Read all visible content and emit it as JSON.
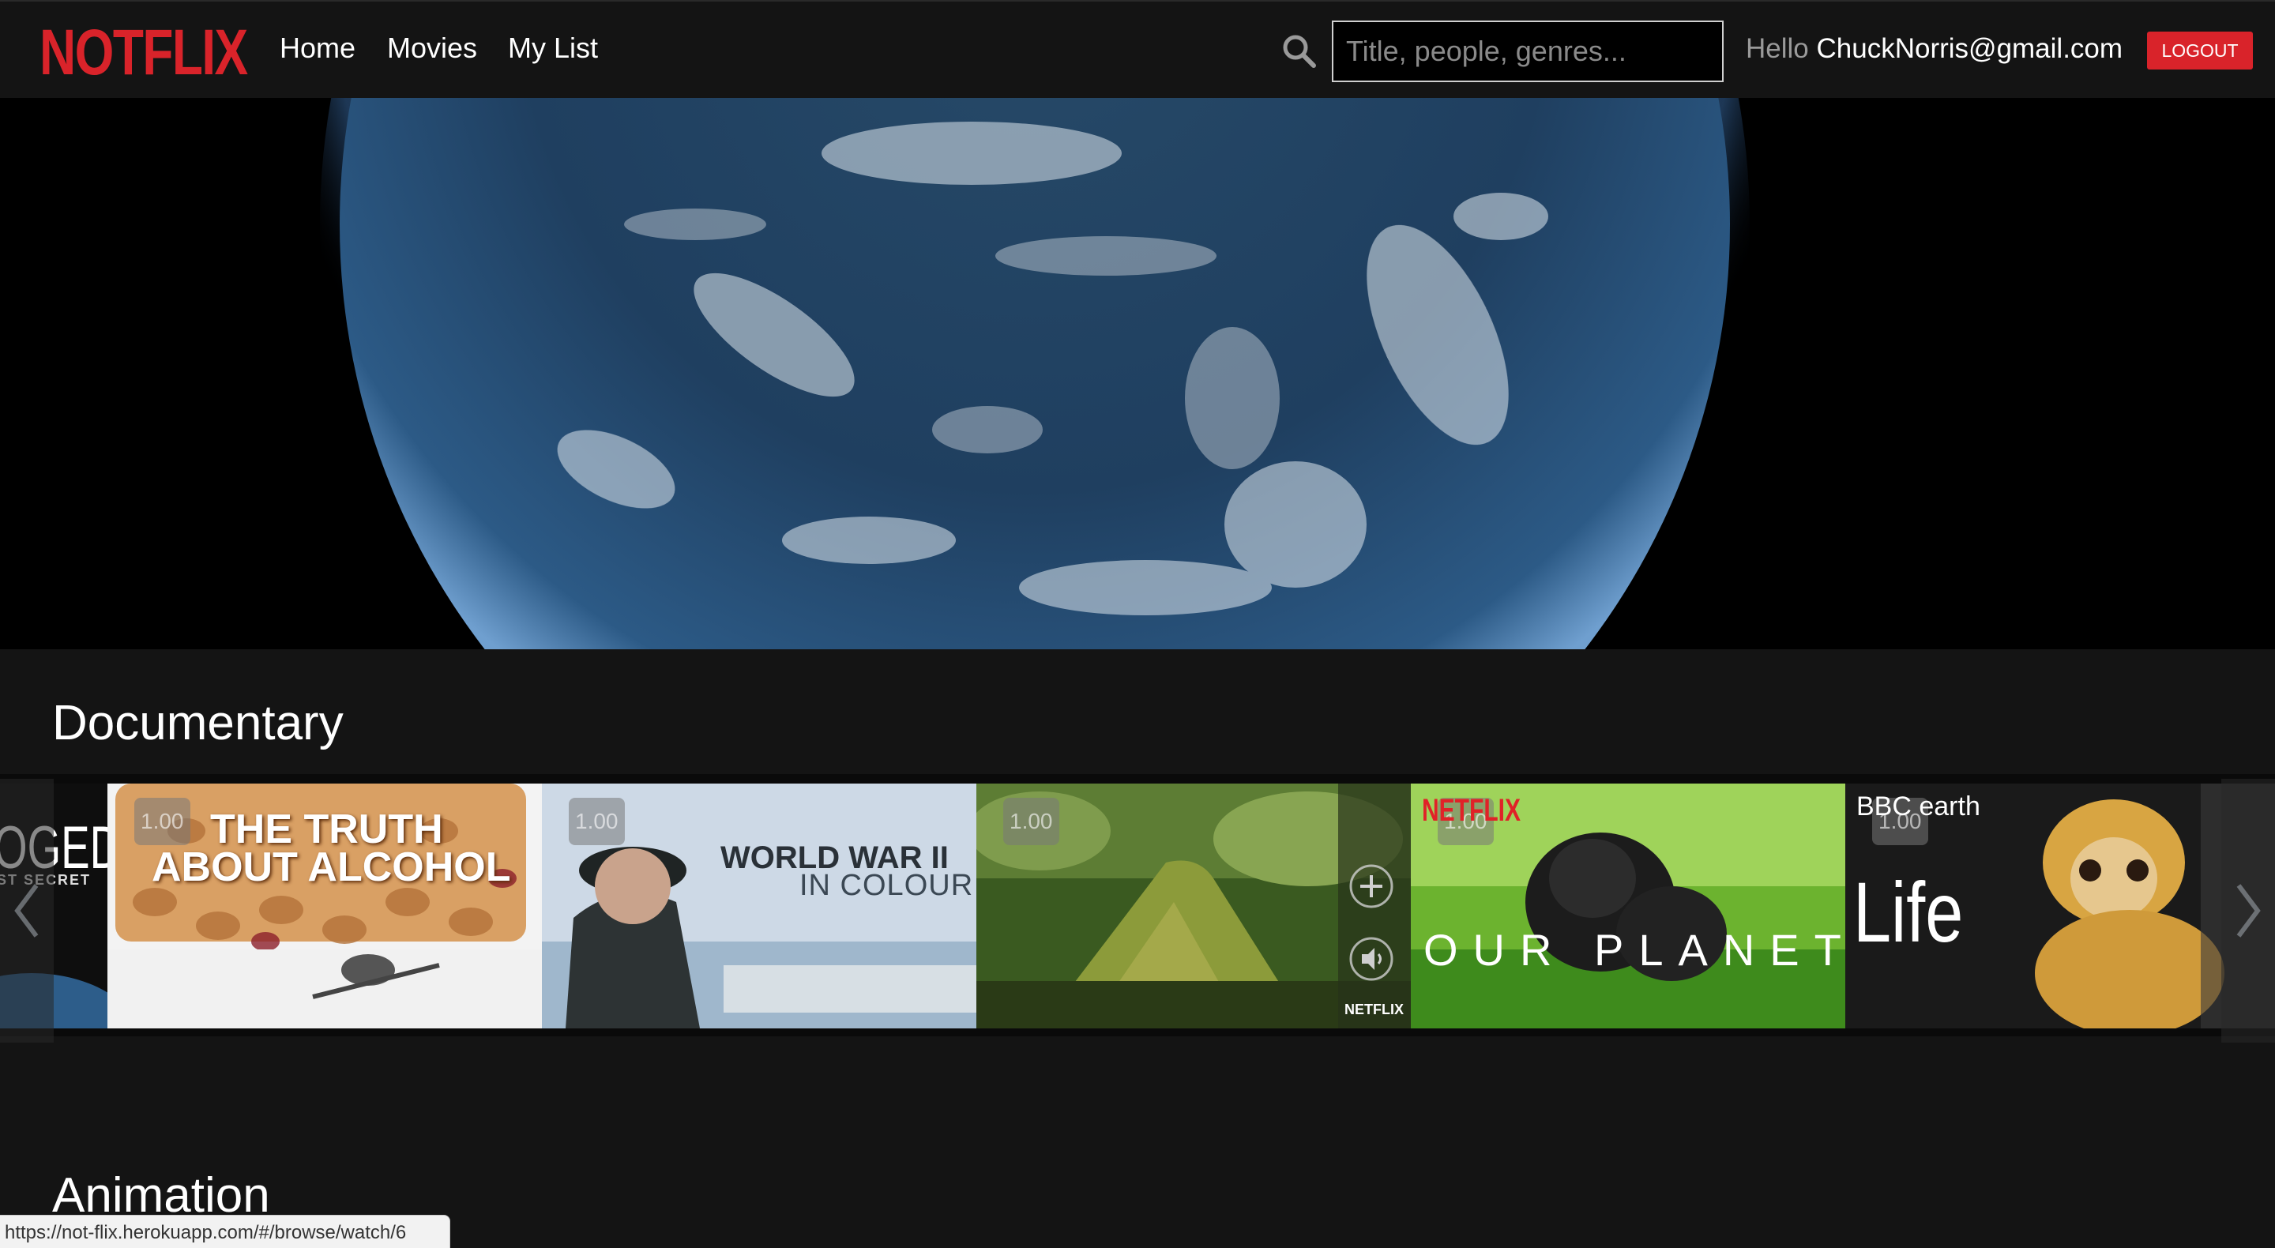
{
  "app": {
    "logo": "NOTFLIX",
    "brand_color": "#d9232a"
  },
  "nav": {
    "links": [
      "Home",
      "Movies",
      "My List"
    ],
    "search_placeholder": "Title, people, genres...",
    "search_value": "",
    "greeting": "Hello",
    "user_email": "ChuckNorris@gmail.com",
    "logout_label": "LOGOUT"
  },
  "rows": [
    {
      "title": "Documentary",
      "tiles": [
        {
          "name": "partial-left",
          "text_main": "OGED",
          "text_sub": "ST SECRET"
        },
        {
          "name": "the-truth-about-alcohol",
          "rating": "1.00",
          "line1": "THE TRUTH",
          "line2": "ABOUT ALCOHOL"
        },
        {
          "name": "world-war-ii-in-colour",
          "rating": "1.00",
          "line1": "WORLD WAR II",
          "line2": "IN COLOUR"
        },
        {
          "name": "forest-documentary",
          "rating": "1.00",
          "badge": "NETFLIX"
        },
        {
          "name": "our-planet",
          "rating": "1.00",
          "brand": "NETFLIX",
          "title": "OUR PLANET"
        },
        {
          "name": "life",
          "rating": "1.00",
          "brand": "BBC earth",
          "title": "Life"
        }
      ]
    },
    {
      "title": "Animation"
    }
  ],
  "status_url": "https://not-flix.herokuapp.com/#/browse/watch/6"
}
